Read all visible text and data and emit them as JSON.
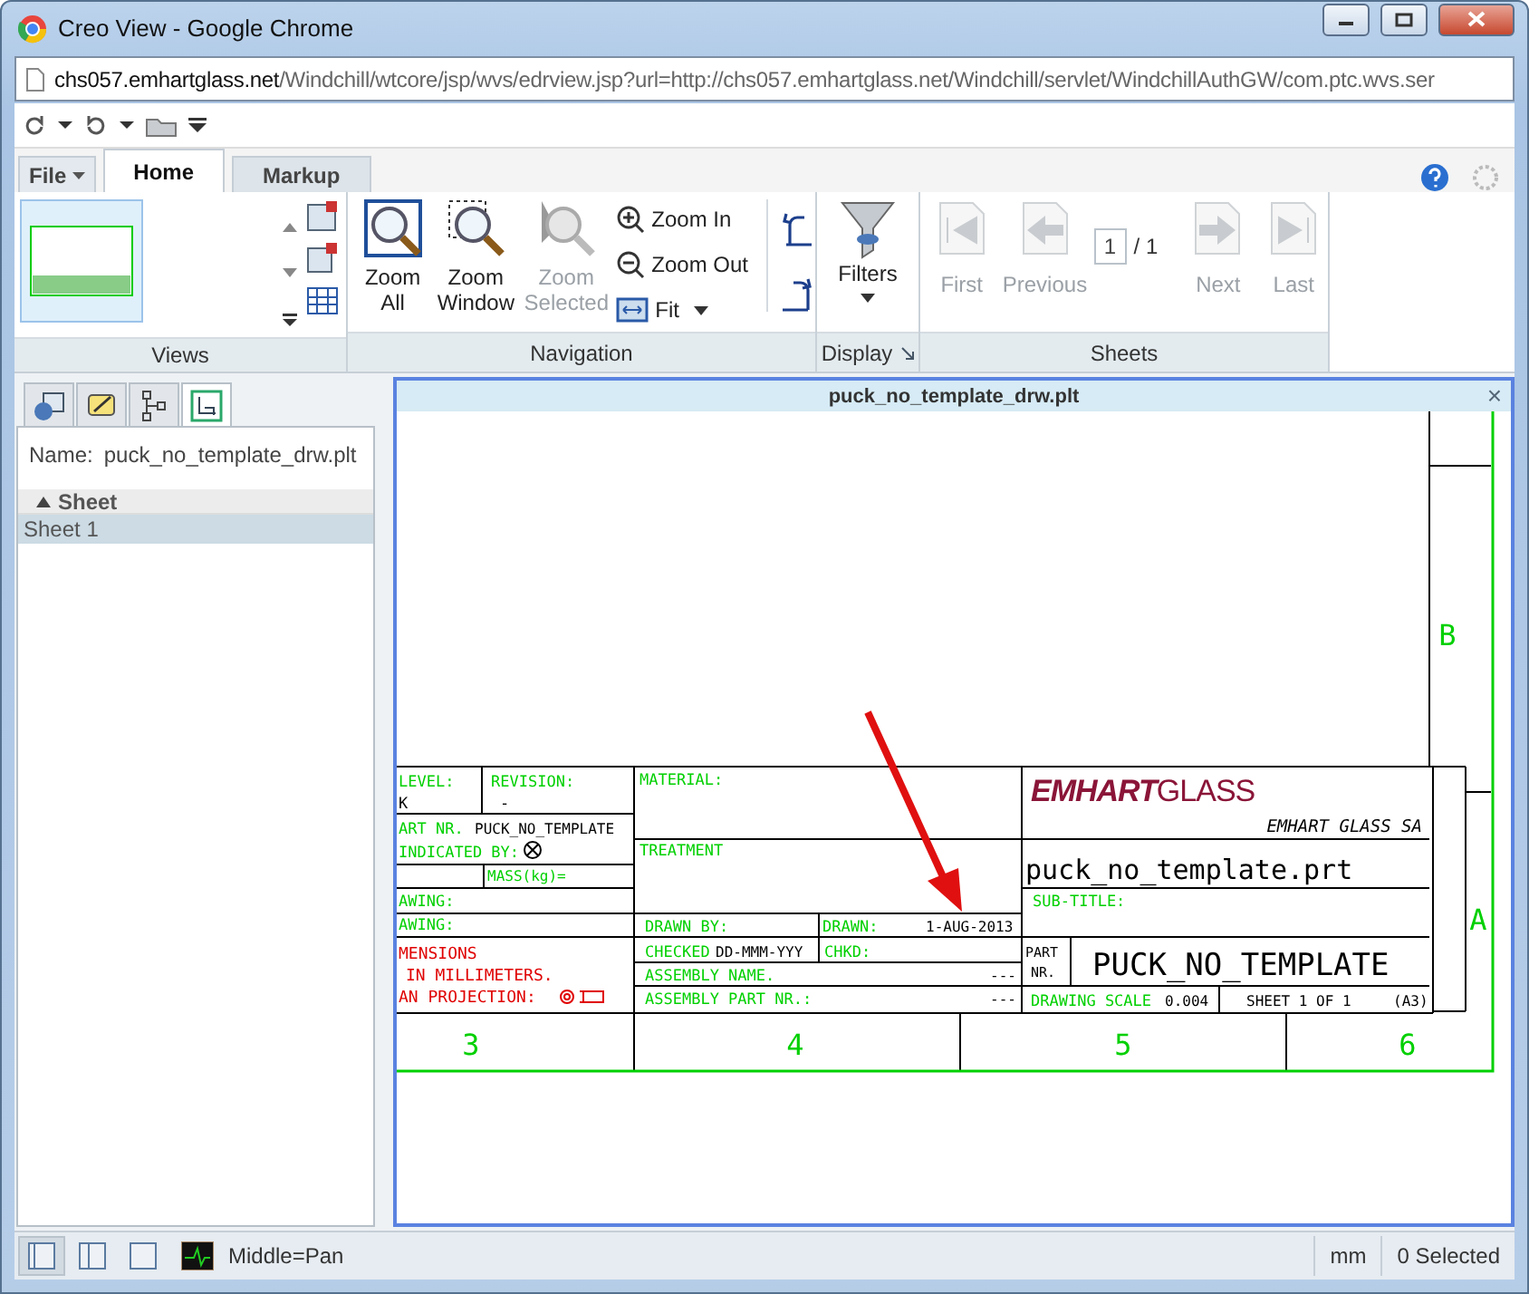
{
  "window": {
    "title": "Creo View - Google Chrome"
  },
  "address_bar": {
    "host": "chs057.emhartglass.net",
    "path": "/Windchill/wtcore/jsp/wvs/edrview.jsp?url=http://chs057.emhartglass.net/Windchill/servlet/WindchillAuthGW/com.ptc.wvs.ser"
  },
  "ribbon_tabs": [
    {
      "label": "File",
      "kind": "menu",
      "selected": false
    },
    {
      "label": "Home",
      "kind": "tab",
      "selected": true
    },
    {
      "label": "Markup",
      "kind": "tab",
      "selected": false
    }
  ],
  "ribbon": {
    "navigation": {
      "large_buttons": [
        {
          "label": "Zoom All",
          "kind": "zoom-all",
          "disabled": false
        },
        {
          "label": "Zoom Window",
          "kind": "zoom-window",
          "disabled": false
        },
        {
          "label": "Zoom Selected",
          "kind": "zoom-selected",
          "disabled": true
        }
      ],
      "small_buttons": [
        {
          "label": "Zoom In",
          "kind": "zoom-in"
        },
        {
          "label": "Zoom Out",
          "kind": "zoom-out"
        },
        {
          "label": "Fit",
          "kind": "fit"
        }
      ]
    },
    "display": {
      "label": "Filters"
    },
    "sheets": {
      "buttons": [
        {
          "label": "First",
          "kind": "first",
          "disabled": true
        },
        {
          "label": "Previous",
          "kind": "previous",
          "disabled": true
        },
        {
          "label": "Next",
          "kind": "next",
          "disabled": true
        },
        {
          "label": "Last",
          "kind": "last",
          "disabled": true
        }
      ],
      "page": "1",
      "total": "/ 1"
    },
    "group_labels": [
      "Views",
      "Navigation",
      "Display",
      "Sheets"
    ]
  },
  "left_panel": {
    "tabs": [
      {
        "kind": "model",
        "selected": false
      },
      {
        "kind": "markup",
        "selected": false
      },
      {
        "kind": "tree",
        "selected": false
      },
      {
        "kind": "sheet",
        "selected": true
      }
    ],
    "name_label": "Name:",
    "name_value": "puck_no_template_drw.plt",
    "groups": [
      {
        "label": "Sheet",
        "expanded": true,
        "items": [
          {
            "label": "Sheet 1",
            "selected": true
          }
        ]
      }
    ]
  },
  "viewer": {
    "title": "puck_no_template_drw.plt",
    "close": "×"
  },
  "drawing": {
    "level_label": "LEVEL:",
    "level_value": "K",
    "revision_label": "REVISION:",
    "revision_value": "-",
    "part_nr_label": "ART NR.",
    "part_nr_value": "PUCK_NO_TEMPLATE",
    "indicated_by_label": "INDICATED BY:",
    "mass_label": "MASS(kg)=",
    "drawing_label_1": "AWING:",
    "drawing_label_2": "AWING:",
    "notes": [
      "MENSIONS",
      "IN MILLIMETERS.",
      "AN PROJECTION:"
    ],
    "material_label": "MATERIAL:",
    "treatment_label": "TREATMENT",
    "drawn_by_label": "DRAWN BY:",
    "drawn_label": "DRAWN:",
    "drawn_date": "1-AUG-2013",
    "checked_label": "CHECKED",
    "checked_date": "DD-MMM-YYY",
    "chkd_label": "CHKD:",
    "assembly_name_label": "ASSEMBLY NAME.",
    "assembly_name_value": "---",
    "assembly_part_label": "ASSEMBLY PART NR.:",
    "assembly_part_value": "---",
    "logo_bold": "EMHART",
    "logo_light": "GLASS",
    "company_name": "EMHART GLASS SA",
    "title": "puck_no_template.prt",
    "subtitle_label": "SUB-TITLE:",
    "part_label": "PART",
    "nr_label": "NR.",
    "part_number": "PUCK_NO_TEMPLATE",
    "scale_label": "DRAWING SCALE",
    "scale_value": "0.004",
    "sheet": "SHEET 1 OF 1",
    "format": "(A3)",
    "zone_columns": [
      "3",
      "4",
      "5",
      "6"
    ],
    "zone_rows": [
      "B",
      "A"
    ]
  },
  "status_bar": {
    "view_buttons": [
      {
        "selected": true
      },
      {
        "selected": false
      },
      {
        "selected": false
      }
    ],
    "mouse_hint": "Middle=Pan",
    "units": "mm",
    "selection": "0 Selected"
  }
}
